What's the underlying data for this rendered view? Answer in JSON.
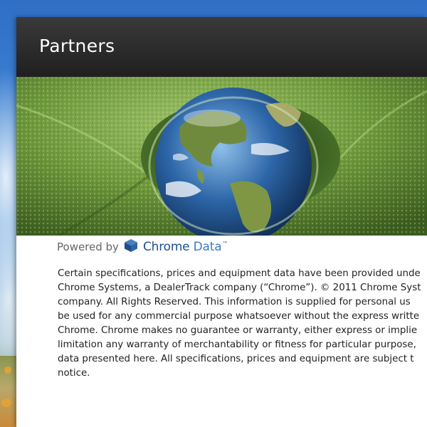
{
  "panel": {
    "title": "Partners"
  },
  "powered_by": {
    "label": "Powered by",
    "brand_primary": "Chrome",
    "brand_secondary": " Data",
    "trademark": "™",
    "logo_icon": "chrome-data-cube-icon",
    "brand_color": "#1f4f8a"
  },
  "notice": {
    "lines": [
      "Certain specifications, prices and equipment data have been provided unde",
      "Chrome Systems, a DealerTrack company (“Chrome”). © 2011 Chrome Syst",
      "company. All Rights Reserved. This information is supplied for personal us",
      "be used for any commercial purpose whatsoever without the express writte",
      "Chrome. Chrome makes no guarantee or warranty, either express or implie",
      "limitation any warranty of merchantability or fitness for particular purpose,",
      "data presented here. All specifications, prices and equipment are subject t",
      "notice."
    ]
  },
  "colors": {
    "header_bg": "#2a2a2a",
    "header_text": "#ffffff",
    "body_text": "#222222"
  }
}
